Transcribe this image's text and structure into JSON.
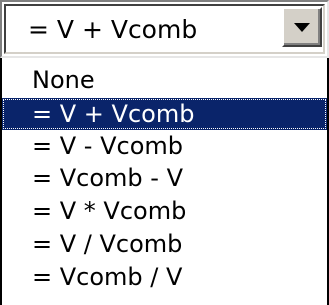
{
  "combobox": {
    "selected_value": "= V + Vcomb",
    "button_icon": "chevron-down-icon"
  },
  "dropdown": {
    "options": [
      {
        "label": "None",
        "selected": false
      },
      {
        "label": "= V + Vcomb",
        "selected": true
      },
      {
        "label": "= V - Vcomb",
        "selected": false
      },
      {
        "label": "= Vcomb - V",
        "selected": false
      },
      {
        "label": "= V * Vcomb",
        "selected": false
      },
      {
        "label": "= V / Vcomb",
        "selected": false
      },
      {
        "label": "= Vcomb / V",
        "selected": false
      }
    ]
  },
  "colors": {
    "selection_background": "#0a246a",
    "selection_text": "#ffffff",
    "face": "#d4d0c8"
  }
}
